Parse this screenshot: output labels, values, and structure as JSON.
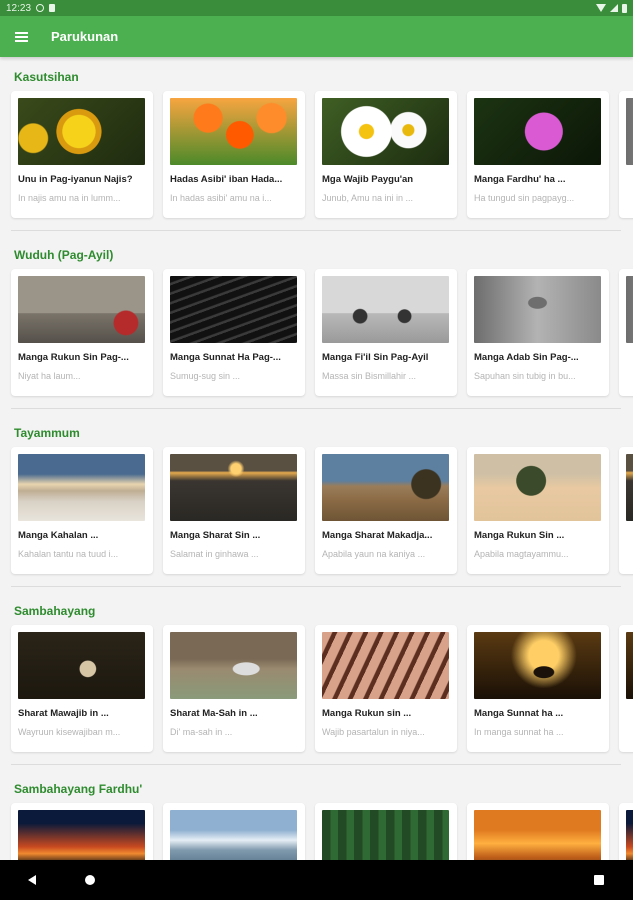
{
  "status_bar": {
    "time": "12:23"
  },
  "app_bar": {
    "title": "Parukunan"
  },
  "sections": [
    {
      "title": "Kasutsihan",
      "cards": [
        {
          "title": "Unu in Pag-iyanun Najis?",
          "subtitle": "In najis amu na in lumm..."
        },
        {
          "title": "Hadas Asibi' iban Hada...",
          "subtitle": "In hadas asibi' amu na i..."
        },
        {
          "title": "Mga Wajib Paygu'an",
          "subtitle": "Junub, Amu na ini in ..."
        },
        {
          "title": "Manga Fardhu' ha ...",
          "subtitle": "Ha tungud sin pagpayg..."
        }
      ]
    },
    {
      "title": "Wuduh (Pag-Ayil)",
      "cards": [
        {
          "title": "Manga Rukun Sin Pag-...",
          "subtitle": "Niyat ha laum..."
        },
        {
          "title": "Manga Sunnat Ha Pag-...",
          "subtitle": "Sumug-sug sin ..."
        },
        {
          "title": "Manga Fi'il Sin Pag-Ayil",
          "subtitle": "Massa sin Bismillahir ..."
        },
        {
          "title": "Manga Adab Sin Pag-...",
          "subtitle": "Sapuhan sin tubig in bu..."
        }
      ]
    },
    {
      "title": "Tayammum",
      "cards": [
        {
          "title": "Manga Kahalan ...",
          "subtitle": "Kahalan tantu na tuud i..."
        },
        {
          "title": "Manga Sharat Sin ...",
          "subtitle": "Salamat in ginhawa ..."
        },
        {
          "title": "Manga Sharat Makadja...",
          "subtitle": "Apabila yaun na kaniya ..."
        },
        {
          "title": "Manga Rukun Sin ...",
          "subtitle": "Apabila magtayammu..."
        }
      ]
    },
    {
      "title": "Sambahayang",
      "cards": [
        {
          "title": "Sharat Mawajib in ...",
          "subtitle": "Wayruun kisewajiban m..."
        },
        {
          "title": "Sharat Ma-Sah in ...",
          "subtitle": "Di' ma-sah in ..."
        },
        {
          "title": "Manga Rukun sin ...",
          "subtitle": "Wajib pasartalun in niya..."
        },
        {
          "title": "Manga Sunnat ha ...",
          "subtitle": "In manga sunnat ha ..."
        }
      ]
    },
    {
      "title": "Sambahayang Fardhu'",
      "cards": [
        {
          "title": "",
          "subtitle": ""
        },
        {
          "title": "",
          "subtitle": ""
        },
        {
          "title": "",
          "subtitle": ""
        },
        {
          "title": "",
          "subtitle": ""
        }
      ]
    }
  ],
  "icons": {
    "menu": "hamburger-icon",
    "back": "triangle-back-icon",
    "home": "circle-home-icon",
    "recents": "square-recents-icon"
  },
  "colors": {
    "app_bar": "#4caf50",
    "status_bar": "#3a8d3a",
    "section_title": "#2e8b2e",
    "background": "#f3f3f3"
  }
}
